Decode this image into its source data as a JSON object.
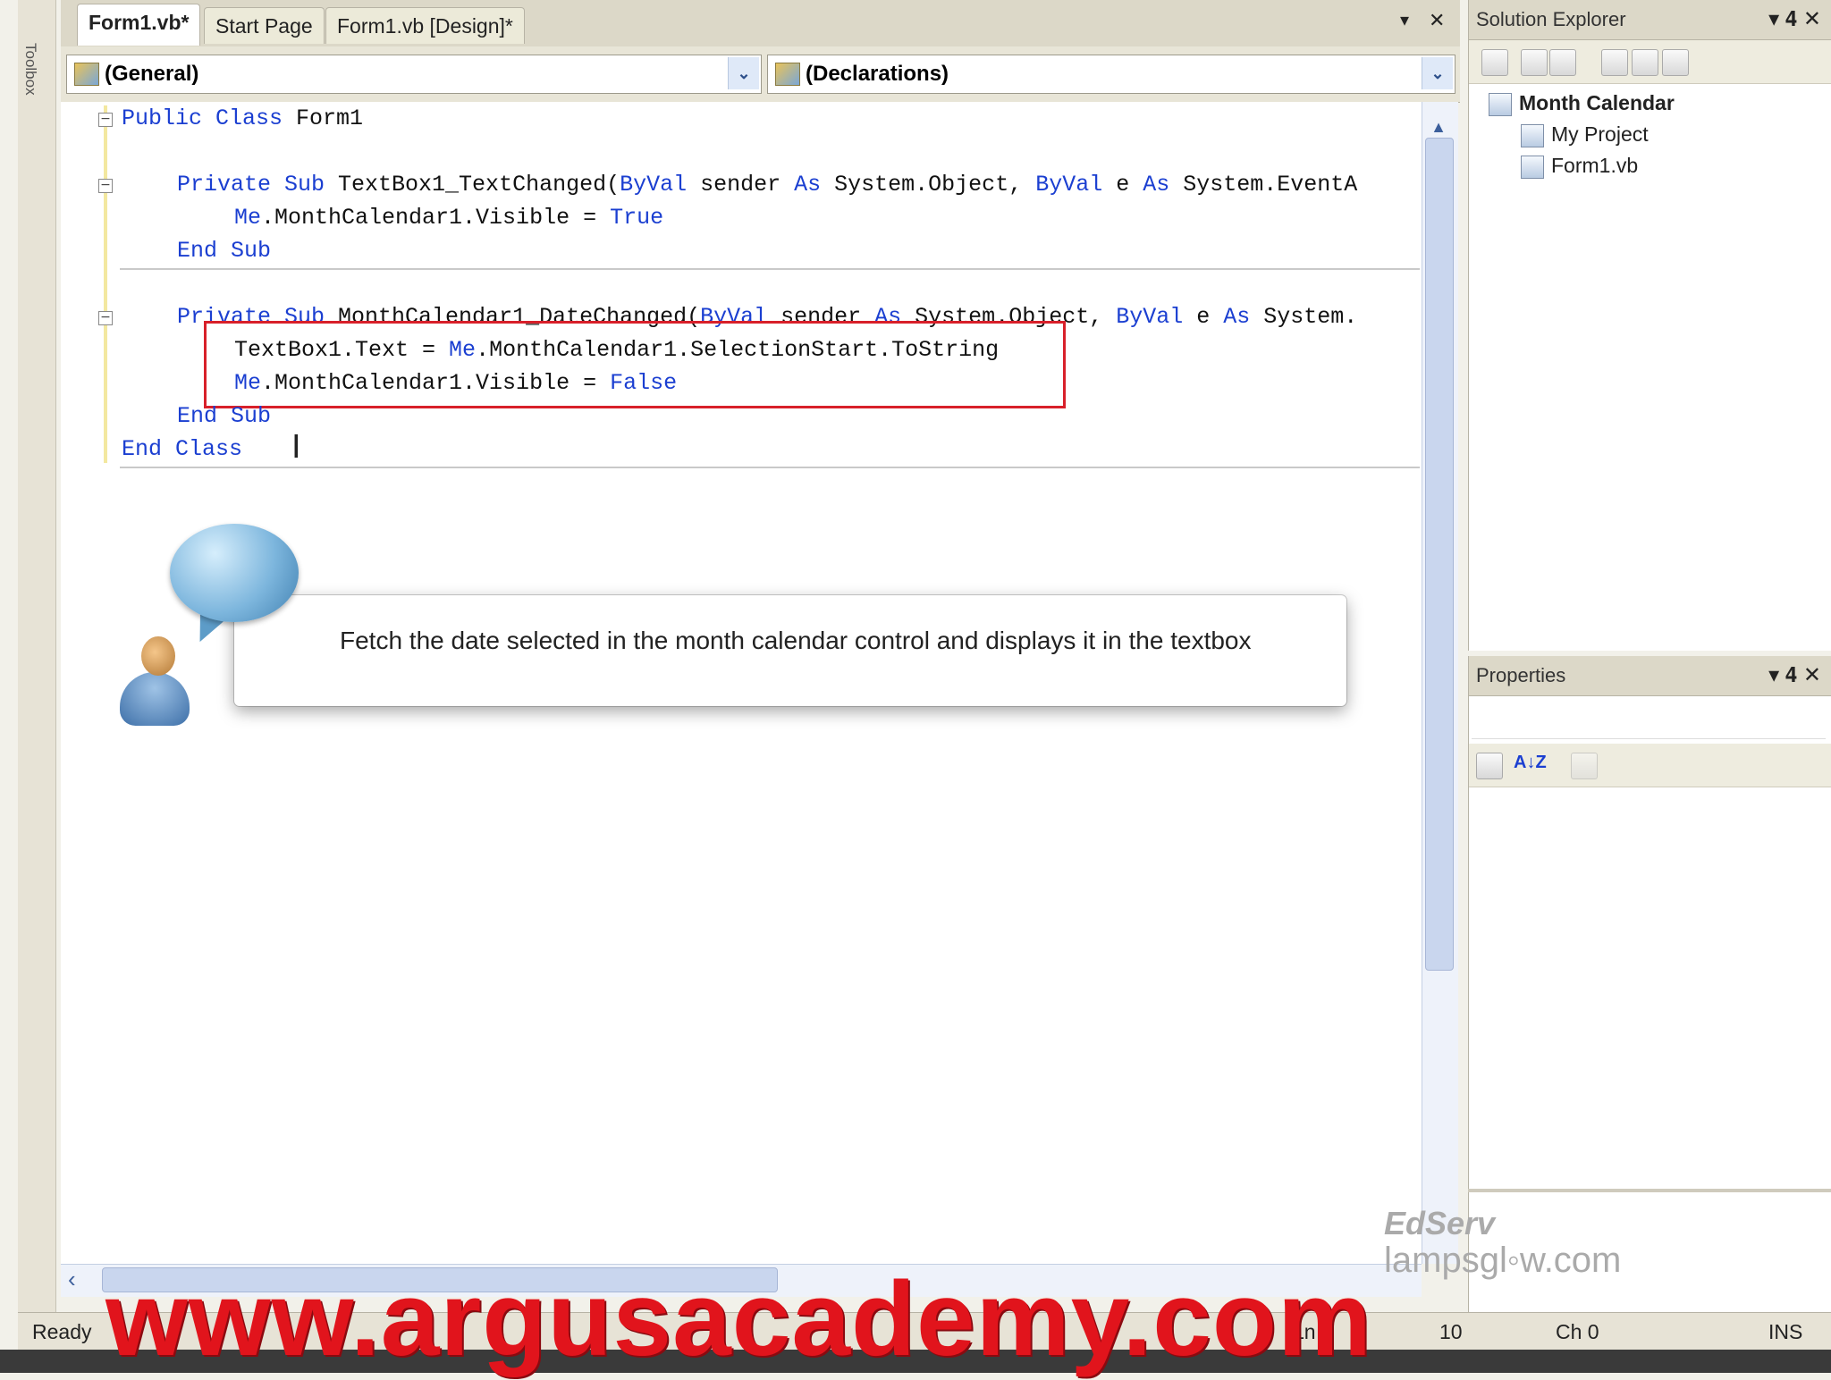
{
  "toolbox": {
    "label": "Toolbox"
  },
  "tabs": [
    {
      "label": "Form1.vb*",
      "active": true
    },
    {
      "label": "Start Page",
      "active": false
    },
    {
      "label": "Form1.vb [Design]*",
      "active": false
    }
  ],
  "tab_controls": {
    "dropdown": "▾",
    "close": "✕"
  },
  "dropdowns": {
    "object": "(General)",
    "member": "(Declarations)",
    "arrow": "⌄"
  },
  "code": {
    "line1": {
      "kw": "Public Class",
      "rest": " Form1"
    },
    "line2": {
      "kw1": "Private Sub",
      "mid1": " TextBox1_TextChanged(",
      "kw2": "ByVal",
      "mid2": " sender ",
      "kw3": "As",
      "mid3": " System.Object, ",
      "kw4": "ByVal",
      "mid4": " e ",
      "kw5": "As",
      "rest": " System.EventA"
    },
    "line3": {
      "kw1": "Me",
      "mid": ".MonthCalendar1.Visible = ",
      "kw2": "True"
    },
    "line4": {
      "kw": "End Sub"
    },
    "line5": {
      "kw1": "Private Sub",
      "mid1": " MonthCalendar1_DateChanged(",
      "kw2": "ByVal",
      "mid2": " sender ",
      "kw3": "As",
      "mid3": " System.Object, ",
      "kw4": "ByVal",
      "mid4": " e ",
      "kw5": "As",
      "rest": " System."
    },
    "line6": {
      "pre": "TextBox1.Text = ",
      "kw": "Me",
      "rest": ".MonthCalendar1.SelectionStart.ToString"
    },
    "line7": {
      "kw1": "Me",
      "mid": ".MonthCalendar1.Visible = ",
      "kw2": "False"
    },
    "line8": {
      "kw": "End Sub"
    },
    "line9": {
      "kw": "End Class"
    },
    "cursor": "I"
  },
  "callout": {
    "text": "Fetch the date selected in the month calendar control and displays it in the textbox"
  },
  "solution_explorer": {
    "title": "Solution Explorer",
    "pin": "▾ 𝟒 ✕",
    "items": [
      {
        "label": "Month Calendar",
        "bold": true
      },
      {
        "label": "My Project"
      },
      {
        "label": "Form1.vb"
      }
    ]
  },
  "properties": {
    "title": "Properties",
    "controls": "▾ 𝟒 ✕",
    "sort_label": "A↓Z"
  },
  "watermarks": {
    "edserv": "EdServ",
    "lampsglow": "lampsgl◦w.com"
  },
  "status": {
    "ready": "Ready",
    "ln": "Ln",
    "col": "10",
    "ch": "Ch 0",
    "ins": "INS"
  },
  "brand": "www.argusacademy.com"
}
